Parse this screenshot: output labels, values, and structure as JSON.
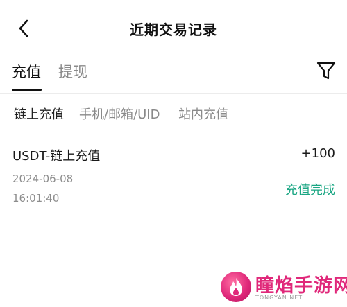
{
  "header": {
    "title": "近期交易记录"
  },
  "tabs": [
    {
      "label": "充值",
      "active": true
    },
    {
      "label": "提现",
      "active": false
    }
  ],
  "subtabs": [
    {
      "label": "链上充值",
      "active": true
    },
    {
      "label": "手机/邮箱/UID",
      "active": false
    },
    {
      "label": "站内充值",
      "active": false
    }
  ],
  "records": [
    {
      "title": "USDT-链上充值",
      "amount": "+100",
      "date": "2024-06-08",
      "time": "16:01:40",
      "status": "充值完成"
    }
  ],
  "watermark": {
    "text": "瞳焰手游网",
    "sub": "TONGYAN.NET"
  },
  "colors": {
    "status_success": "#1aa683",
    "text_primary": "#1a1a1a",
    "text_secondary": "#8a8a8a",
    "watermark": "#e0287a"
  },
  "icons": {
    "back": "chevron-left-icon",
    "filter": "funnel-icon"
  }
}
